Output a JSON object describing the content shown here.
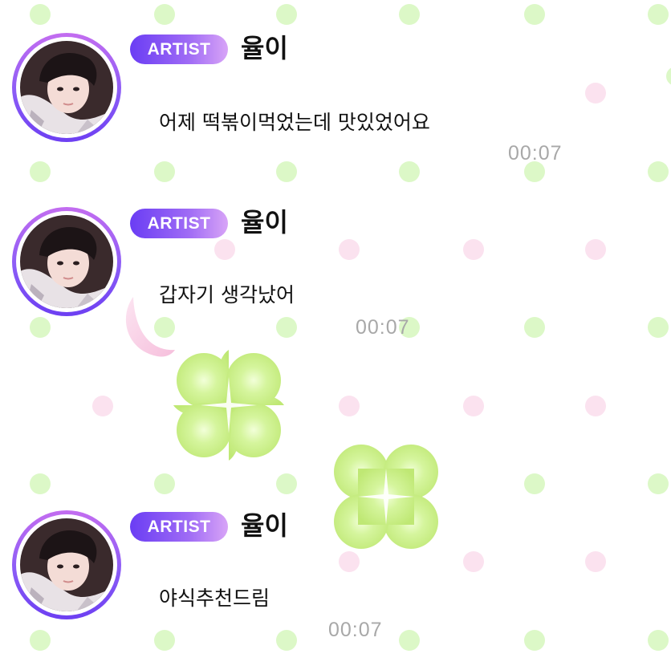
{
  "messages": [
    {
      "badge": "ARTIST",
      "name": "율이",
      "text": "어제 떡볶이먹었는데 맛있었어요",
      "time": "00:07"
    },
    {
      "badge": "ARTIST",
      "name": "율이",
      "text": "갑자기 생각났어",
      "time": "00:07"
    },
    {
      "badge": "ARTIST",
      "name": "율이",
      "text": "야식추천드림",
      "time": "00:07"
    }
  ],
  "colors": {
    "badge_gradient": [
      "#6a3df4",
      "#d8a4f7"
    ],
    "avatar_ring": [
      "#c36df0",
      "#6d3ff2"
    ],
    "dot_green": "#d9f7c4",
    "dot_pink": "#fbe0ee",
    "clover": "#c8f08a",
    "timestamp": "#a8a8a8"
  },
  "icons": {
    "clover": "four-leaf-clover-icon",
    "moon": "crescent-moon-icon"
  }
}
